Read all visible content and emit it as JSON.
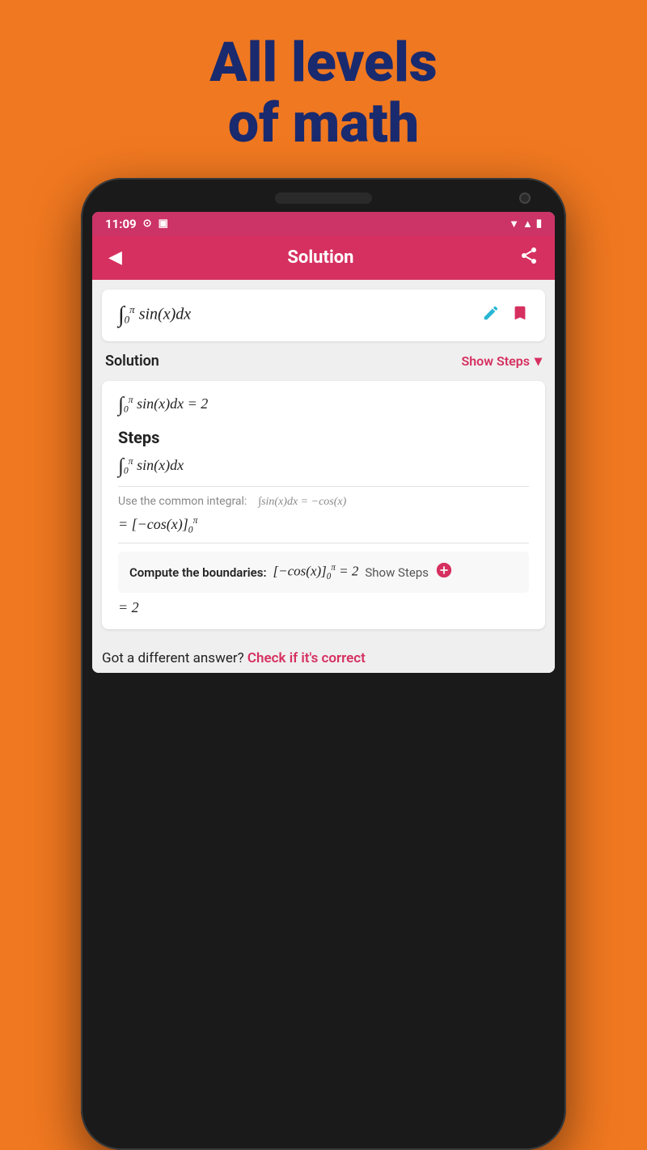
{
  "headline": {
    "line1": "All levels",
    "line2": "of math"
  },
  "status_bar": {
    "time": "11:09",
    "icons_left": [
      "@",
      "□"
    ],
    "wifi": "▼",
    "signal": "▲",
    "battery": "▮"
  },
  "header": {
    "title": "Solution",
    "back_label": "◀",
    "share_label": "⊲"
  },
  "formula_card": {
    "formula": "∫₀^π sin(x)dx",
    "pencil_icon": "✏",
    "bookmark_icon": "🔖"
  },
  "solution_section": {
    "label": "Solution",
    "show_steps_label": "Show Steps",
    "chevron": "▾"
  },
  "solution_card": {
    "answer": "∫₀^π sin(x)dx = 2",
    "steps_heading": "Steps",
    "integral": "∫₀^π sin(x)dx",
    "hint_prefix": "Use the common integral:",
    "hint_formula": "∫sin(x)dx = −cos(x)",
    "eval_line": "= [−cos(x)]₀^π",
    "boundary_label": "Compute the boundaries:",
    "boundary_expr": "[−cos(x)]₀^π = 2",
    "show_steps_inline": "Show Steps",
    "result": "= 2"
  },
  "bottom_bar": {
    "text": "Got a different answer?",
    "link": "Check if it's correct"
  }
}
